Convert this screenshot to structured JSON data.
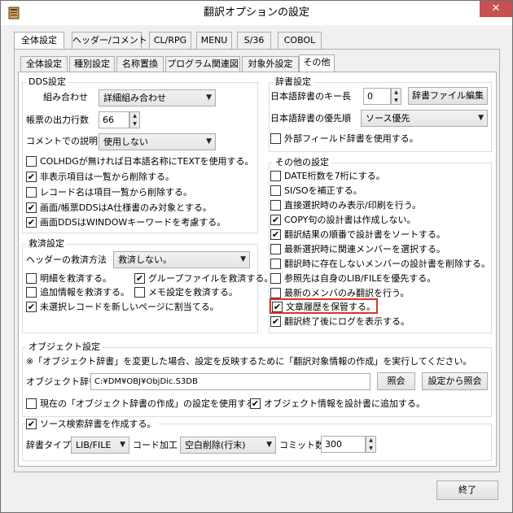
{
  "window": {
    "title": "翻訳オプションの設定",
    "close_glyph": "✕",
    "icon": "app-document-icon"
  },
  "top_tabs": [
    "全体設定",
    "ヘッダー/コメント",
    "CL/RPG",
    "MENU",
    "S/36",
    "COBOL"
  ],
  "sub_tabs": [
    "全体設定",
    "種別設定",
    "名称置換",
    "プログラム関連図",
    "対象外設定",
    "その他"
  ],
  "dds": {
    "title": "DDS設定",
    "combine_label": "組み合わせ",
    "combine_value": "詳細組み合わせ",
    "report_rows_label": "帳票の出力行数",
    "report_rows_value": "66",
    "comment_label": "コメントでの説明",
    "comment_value": "使用しない",
    "checks": [
      {
        "label": "COLHDGが無ければ日本語名称にTEXTを使用する。",
        "checked": false
      },
      {
        "label": "非表示項目は一覧から削除する。",
        "checked": true
      },
      {
        "label": "レコード名は項目一覧から削除する。",
        "checked": false
      },
      {
        "label": "画面/帳票DDSはA仕様書のみ対象とする。",
        "checked": true
      },
      {
        "label": "画面DDSはWINDOWキーワードを考慮する。",
        "checked": true
      }
    ]
  },
  "rescue": {
    "title": "救済設定",
    "header_label": "ヘッダーの救済方法",
    "header_value": "救済しない。",
    "checks": [
      {
        "label": "明細を救済する。",
        "checked": false
      },
      {
        "label": "グループファイルを救済する。",
        "checked": true
      },
      {
        "label": "追加情報を救済する。",
        "checked": false
      },
      {
        "label": "メモ設定を救済する。",
        "checked": false
      },
      {
        "label": "未選択レコードを新しいページに割当てる。",
        "checked": true
      }
    ]
  },
  "dict": {
    "title": "辞書設定",
    "key_len_label": "日本語辞書のキー長",
    "key_len_value": "0",
    "edit_button": "辞書ファイル編集",
    "priority_label": "日本語辞書の優先順",
    "priority_value": "ソース優先",
    "external_check": {
      "label": "外部フィールド辞書を使用する。",
      "checked": false
    }
  },
  "other": {
    "title": "その他の設定",
    "checks": [
      {
        "label": "DATE桁数を7桁にする。",
        "checked": false
      },
      {
        "label": "SI/SOを補正する。",
        "checked": false
      },
      {
        "label": "直接選択時のみ表示/印刷を行う。",
        "checked": false
      },
      {
        "label": "COPY句の設計書は作成しない。",
        "checked": true
      },
      {
        "label": "翻訳結果の順番で設計書をソートする。",
        "checked": true
      },
      {
        "label": "最新選択時に関連メンバーを選択する。",
        "checked": false
      },
      {
        "label": "翻訳時に存在しないメンバーの設計書を削除する。",
        "checked": false
      },
      {
        "label": "参照先は自身のLIB/FILEを優先する。",
        "checked": false
      },
      {
        "label": "最新のメンバのみ翻訳を行う。",
        "checked": false
      },
      {
        "label": "文章履歴を保管する。",
        "checked": true
      },
      {
        "label": "翻訳終了後にログを表示する。",
        "checked": true
      }
    ]
  },
  "object": {
    "title": "オブジェクト設定",
    "note": "※「オブジェクト辞書」を変更した場合、設定を反映するために「翻訳対象情報の作成」を実行してください。",
    "dict_label": "オブジェクト辞書",
    "dict_path": "C:¥DM¥OBJ¥ObjDic.S3DB",
    "ref_button": "照会",
    "setting_ref_button": "設定から照会",
    "checks": [
      {
        "label": "現在の「オブジェクト辞書の作成」の設定を使用する。",
        "checked": false
      },
      {
        "label": "オブジェクト情報を設計書に追加する。",
        "checked": true
      }
    ]
  },
  "source": {
    "check": {
      "label": "ソース検索辞書を作成する。",
      "checked": true
    },
    "dict_type_label": "辞書タイプ",
    "dict_type_value": "LIB/FILE",
    "code_label": "コード加工",
    "code_value": "空白削除(行末)",
    "commit_label": "コミット数",
    "commit_value": "300"
  },
  "footer": {
    "exit_button": "終了"
  },
  "glyphs": {
    "check": "✔",
    "dropdown": "▼",
    "spin_up": "▲",
    "spin_down": "▼"
  }
}
